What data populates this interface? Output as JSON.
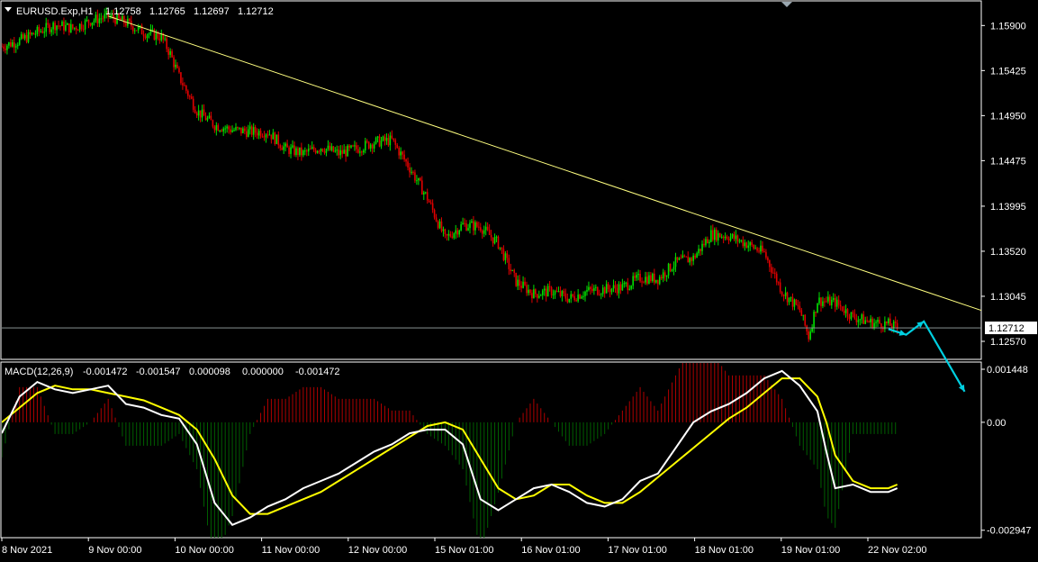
{
  "chart_data": [
    {
      "type": "candlestick",
      "title": "EURUSD.Exp,H1",
      "ohlc_readout": [
        "1.12758",
        "1.12765",
        "1.12697",
        "1.12712"
      ],
      "ylim": [
        1.1238,
        1.1615
      ],
      "y_ticks": [
        "1.15900",
        "1.15425",
        "1.14950",
        "1.14475",
        "1.13995",
        "1.13520",
        "1.13045",
        "1.12570"
      ],
      "current_price": "1.12712",
      "x_tick_labels": [
        "8 Nov 2021",
        "9 Nov 00:00",
        "10 Nov 00:00",
        "11 Nov 00:00",
        "12 Nov 00:00",
        "15 Nov 01:00",
        "16 Nov 01:00",
        "17 Nov 01:00",
        "18 Nov 01:00",
        "19 Nov 01:00",
        "22 Nov 02:00"
      ],
      "close_path": [
        [
          0,
          1.1568
        ],
        [
          10,
          1.1574
        ],
        [
          20,
          1.1583
        ],
        [
          30,
          1.1591
        ],
        [
          40,
          1.1587
        ],
        [
          50,
          1.1595
        ],
        [
          60,
          1.16
        ],
        [
          70,
          1.1593
        ],
        [
          80,
          1.1583
        ],
        [
          90,
          1.1578
        ],
        [
          95,
          1.156
        ],
        [
          100,
          1.1536
        ],
        [
          110,
          1.15
        ],
        [
          120,
          1.1485
        ],
        [
          130,
          1.148
        ],
        [
          140,
          1.1478
        ],
        [
          150,
          1.1478
        ],
        [
          160,
          1.146
        ],
        [
          170,
          1.1455
        ],
        [
          180,
          1.1462
        ],
        [
          190,
          1.1455
        ],
        [
          200,
          1.146
        ],
        [
          210,
          1.1467
        ],
        [
          220,
          1.1469
        ],
        [
          230,
          1.144
        ],
        [
          240,
          1.1408
        ],
        [
          250,
          1.1365
        ],
        [
          260,
          1.138
        ],
        [
          270,
          1.1378
        ],
        [
          280,
          1.136
        ],
        [
          290,
          1.132
        ],
        [
          300,
          1.1307
        ],
        [
          310,
          1.131
        ],
        [
          320,
          1.1302
        ],
        [
          330,
          1.131
        ],
        [
          340,
          1.1312
        ],
        [
          350,
          1.1314
        ],
        [
          360,
          1.1324
        ],
        [
          370,
          1.1323
        ],
        [
          380,
          1.134
        ],
        [
          390,
          1.1345
        ],
        [
          400,
          1.137
        ],
        [
          410,
          1.1368
        ],
        [
          420,
          1.136
        ],
        [
          430,
          1.135
        ],
        [
          440,
          1.131
        ],
        [
          450,
          1.129
        ],
        [
          455,
          1.1262
        ],
        [
          460,
          1.13
        ],
        [
          470,
          1.1298
        ],
        [
          480,
          1.1283
        ],
        [
          490,
          1.1277
        ],
        [
          500,
          1.1275
        ],
        [
          505,
          1.1271
        ]
      ],
      "trend_line": [
        [
          60,
          1.16
        ],
        [
          620,
          1.1247
        ]
      ],
      "arrows": [
        [
          500,
          1.127
        ],
        [
          510,
          1.1264
        ],
        [
          520,
          1.1278
        ],
        [
          543,
          1.1204
        ]
      ],
      "x_range": [
        0,
        560
      ],
      "colors": {
        "bull": "#00e000",
        "bear": "#e00000",
        "trend": "#ffff80",
        "arrow": "#00cfe0"
      }
    },
    {
      "type": "macd",
      "title": "MACD(12,26,9)",
      "readout": [
        "-0.001472",
        "-0.001547",
        "0.000098",
        "0.000000",
        "-0.001472"
      ],
      "ylim": [
        -0.00315,
        0.00162
      ],
      "y_ticks": [
        "0.001448",
        "0.00",
        "-0.002947"
      ],
      "macd_path": [
        [
          0,
          -0.0003
        ],
        [
          10,
          0.0007
        ],
        [
          20,
          0.0011
        ],
        [
          30,
          0.0009
        ],
        [
          40,
          0.0008
        ],
        [
          50,
          0.0009
        ],
        [
          60,
          0.001
        ],
        [
          70,
          0.0005
        ],
        [
          80,
          0.0004
        ],
        [
          90,
          0.0002
        ],
        [
          100,
          0.0001
        ],
        [
          110,
          -0.0006
        ],
        [
          120,
          -0.0022
        ],
        [
          130,
          -0.0028
        ],
        [
          140,
          -0.0026
        ],
        [
          150,
          -0.0023
        ],
        [
          160,
          -0.0021
        ],
        [
          170,
          -0.0018
        ],
        [
          180,
          -0.0016
        ],
        [
          190,
          -0.0014
        ],
        [
          200,
          -0.0011
        ],
        [
          210,
          -0.0008
        ],
        [
          220,
          -0.0006
        ],
        [
          230,
          -0.0003
        ],
        [
          240,
          -0.0002
        ],
        [
          250,
          -0.0002
        ],
        [
          260,
          -0.0006
        ],
        [
          270,
          -0.0021
        ],
        [
          280,
          -0.0024
        ],
        [
          290,
          -0.0021
        ],
        [
          300,
          -0.0018
        ],
        [
          310,
          -0.0017
        ],
        [
          320,
          -0.0019
        ],
        [
          330,
          -0.0022
        ],
        [
          340,
          -0.0023
        ],
        [
          350,
          -0.0021
        ],
        [
          360,
          -0.0016
        ],
        [
          370,
          -0.0014
        ],
        [
          380,
          -0.0007
        ],
        [
          390,
          0.0
        ],
        [
          400,
          0.0003
        ],
        [
          410,
          0.0005
        ],
        [
          420,
          0.0008
        ],
        [
          430,
          0.0012
        ],
        [
          440,
          0.0014
        ],
        [
          450,
          0.001
        ],
        [
          460,
          0.0003
        ],
        [
          465,
          -0.0008
        ],
        [
          470,
          -0.0018
        ],
        [
          480,
          -0.0017
        ],
        [
          490,
          -0.0019
        ],
        [
          500,
          -0.0019
        ],
        [
          505,
          -0.0018
        ]
      ],
      "signal_path": [
        [
          0,
          0.0
        ],
        [
          10,
          0.0004
        ],
        [
          20,
          0.0008
        ],
        [
          30,
          0.001
        ],
        [
          40,
          0.0009
        ],
        [
          50,
          0.0009
        ],
        [
          60,
          0.0008
        ],
        [
          70,
          0.0007
        ],
        [
          80,
          0.0006
        ],
        [
          90,
          0.0004
        ],
        [
          100,
          0.0002
        ],
        [
          110,
          -0.0002
        ],
        [
          120,
          -0.001
        ],
        [
          130,
          -0.002
        ],
        [
          140,
          -0.0025
        ],
        [
          150,
          -0.0025
        ],
        [
          160,
          -0.0023
        ],
        [
          170,
          -0.0021
        ],
        [
          180,
          -0.0019
        ],
        [
          190,
          -0.0016
        ],
        [
          200,
          -0.0013
        ],
        [
          210,
          -0.001
        ],
        [
          220,
          -0.0007
        ],
        [
          230,
          -0.0004
        ],
        [
          240,
          -0.0001
        ],
        [
          250,
          0.0
        ],
        [
          260,
          -0.0002
        ],
        [
          270,
          -0.001
        ],
        [
          280,
          -0.0018
        ],
        [
          290,
          -0.0021
        ],
        [
          300,
          -0.002
        ],
        [
          310,
          -0.0017
        ],
        [
          320,
          -0.0017
        ],
        [
          330,
          -0.002
        ],
        [
          340,
          -0.0022
        ],
        [
          350,
          -0.0022
        ],
        [
          360,
          -0.0019
        ],
        [
          370,
          -0.0015
        ],
        [
          380,
          -0.0011
        ],
        [
          390,
          -0.0007
        ],
        [
          400,
          -0.0003
        ],
        [
          410,
          0.0001
        ],
        [
          420,
          0.0004
        ],
        [
          430,
          0.0008
        ],
        [
          440,
          0.0012
        ],
        [
          450,
          0.0012
        ],
        [
          460,
          0.0007
        ],
        [
          465,
          0.0
        ],
        [
          470,
          -0.0009
        ],
        [
          480,
          -0.0016
        ],
        [
          490,
          -0.0018
        ],
        [
          500,
          -0.0018
        ],
        [
          505,
          -0.0017
        ]
      ],
      "x_range": [
        0,
        560
      ],
      "colors": {
        "macd": "#ffffff",
        "signal": "#ffff00",
        "hist_up": "#b00000",
        "hist_down": "#006000"
      }
    }
  ]
}
